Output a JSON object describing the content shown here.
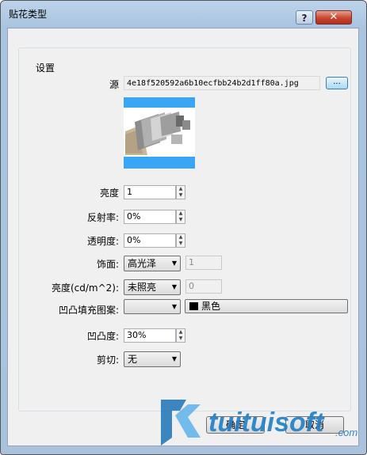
{
  "window": {
    "title": "贴花类型",
    "help_label": "?",
    "close_label": "✕"
  },
  "group": {
    "title": "设置"
  },
  "source": {
    "label": "源",
    "filename": "4e18f520592a6b10ecfbb24b2d1ff80a.jpg",
    "browse_label": "..."
  },
  "brightness": {
    "label": "亮度",
    "value": "1"
  },
  "reflectivity": {
    "label": "反射率:",
    "value": "0%"
  },
  "transparency": {
    "label": "透明度:",
    "value": "0%"
  },
  "finish": {
    "label": "饰面:",
    "selected": "高光泽",
    "value": "1"
  },
  "luminance": {
    "label": "亮度(cd/m^2):",
    "selected": "未照亮",
    "value": "0"
  },
  "bump": {
    "label": "凹凸填充图案:",
    "selected": "",
    "color_label": "黑色",
    "color": "#000000"
  },
  "bumpiness": {
    "label": "凹凸度:",
    "value": "30%"
  },
  "cutout": {
    "label": "剪切:",
    "selected": "无"
  },
  "buttons": {
    "ok": "确定",
    "cancel": "取消"
  },
  "watermark": {
    "text": "tuituisoft",
    "suffix": ".com"
  },
  "colors": {
    "accent": "#38a5f5",
    "window_frame": "#aac3dd",
    "close": "#c8452f"
  }
}
